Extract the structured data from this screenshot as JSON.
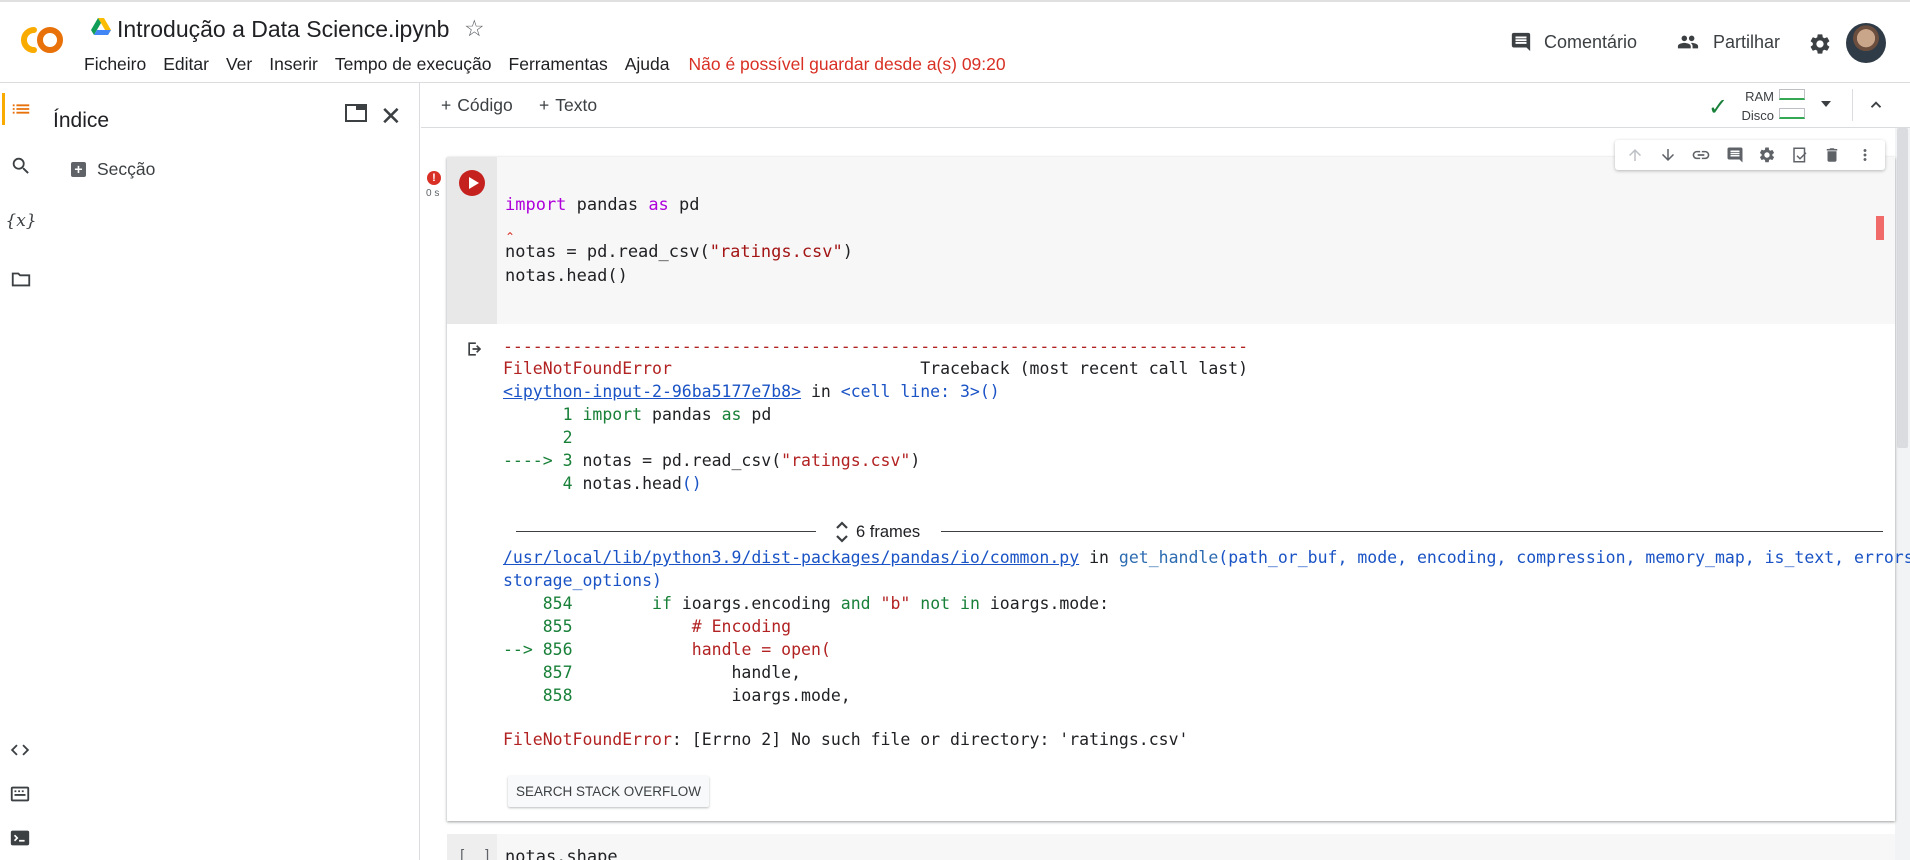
{
  "header": {
    "notebook_title": "Introdução a Data Science.ipynb",
    "menu": [
      "Ficheiro",
      "Editar",
      "Ver",
      "Inserir",
      "Tempo de execução",
      "Ferramentas",
      "Ajuda"
    ],
    "save_warning": "Não é possível guardar desde a(s) 09:20",
    "comment_label": "Comentário",
    "share_label": "Partilhar",
    "logo_text": "CO",
    "colors": {
      "logo_orange": "#f9ab00",
      "warning_red": "#d93025"
    }
  },
  "toolbar": {
    "add_code_label": "Código",
    "add_text_label": "Texto",
    "ram_label": "RAM",
    "disk_label": "Disco"
  },
  "toc": {
    "title": "Índice",
    "section_label": "Secção"
  },
  "cell1": {
    "exec_time": "0 s",
    "code": {
      "line1_kw": "import",
      "line1_rest": " pandas ",
      "line1_as": "as",
      "line1_alias": " pd",
      "line3_pre": "notas = pd.read_csv(",
      "line3_str": "\"ratings.csv\"",
      "line3_post": ")",
      "line4": "notas.head()"
    },
    "output": {
      "dashes": "---------------------------------------------------------------------------",
      "error_name": "FileNotFoundError",
      "traceback_header": "                         Traceback (most recent call last)",
      "input_link": "<ipython-input-2-96ba5177e7b8>",
      "in_word": " in ",
      "cell_line": "<cell line: 3>",
      "cell_line_parens": "()",
      "src": [
        {
          "num": "      1 ",
          "code": "import pandas as pd",
          "arrow": ""
        },
        {
          "num": "      2",
          "code": "",
          "arrow": ""
        },
        {
          "num": " 3 ",
          "code": "notas = pd.read_csv(\"ratings.csv\")",
          "arrow": "---->"
        },
        {
          "num": "      4 ",
          "code": "notas.head()",
          "arrow": ""
        }
      ],
      "frames_label": "6 frames",
      "lib_link": "/usr/local/lib/python3.9/dist-packages/pandas/io/common.py",
      "lib_in": " in ",
      "lib_func": "get_handle",
      "lib_args": "(path_or_buf, mode, encoding, compression, memory_map, is_text, errors,",
      "lib_args2": "storage_options)",
      "lib_src": [
        {
          "num": "    854",
          "code": "        if ioargs.encoding and \"b\" not in ioargs.mode:",
          "arrow": ""
        },
        {
          "num": "    855",
          "code": "            # Encoding",
          "arrow": ""
        },
        {
          "num": " 856",
          "code": "            handle = open(",
          "arrow": "-->"
        },
        {
          "num": "    857",
          "code": "                handle,",
          "arrow": ""
        },
        {
          "num": "    858",
          "code": "                ioargs.mode,",
          "arrow": ""
        }
      ],
      "final_error_name": "FileNotFoundError",
      "final_error_msg": ": [Errno 2] No such file or directory: 'ratings.csv'",
      "so_button": "SEARCH STACK OVERFLOW"
    }
  },
  "cell2": {
    "bracket": "[ ]",
    "code": "notas.shape"
  }
}
